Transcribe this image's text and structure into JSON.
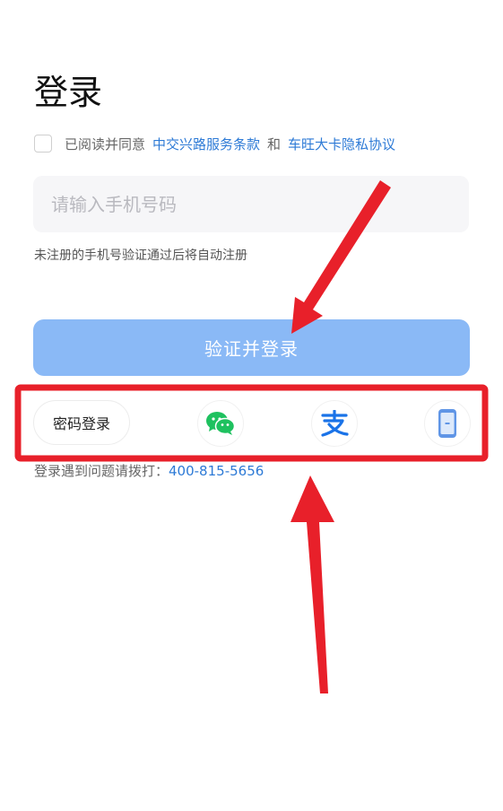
{
  "page": {
    "title": "登录"
  },
  "agreement": {
    "prefix": "已阅读并同意",
    "terms_link": "中交兴路服务条款",
    "conjunction": "和",
    "privacy_link": "车旺大卡隐私协议",
    "checked": false
  },
  "phone_input": {
    "value": "",
    "placeholder": "请输入手机号码"
  },
  "hint_text": "未注册的手机号验证通过后将自动注册",
  "submit_button": {
    "label": "验证并登录"
  },
  "login_options": {
    "password_login": "密码登录",
    "icons": [
      "wechat-icon",
      "alipay-icon",
      "mobile-phone-icon"
    ]
  },
  "help": {
    "prefix": "登录遇到问题请拨打：",
    "phone": "400-815-5656"
  },
  "colors": {
    "link": "#2d7ad6",
    "button_bg": "#8ab9f6",
    "wechat": "#1ec15f",
    "alipay": "#1a73e8",
    "annotation_red": "#e8202a"
  }
}
